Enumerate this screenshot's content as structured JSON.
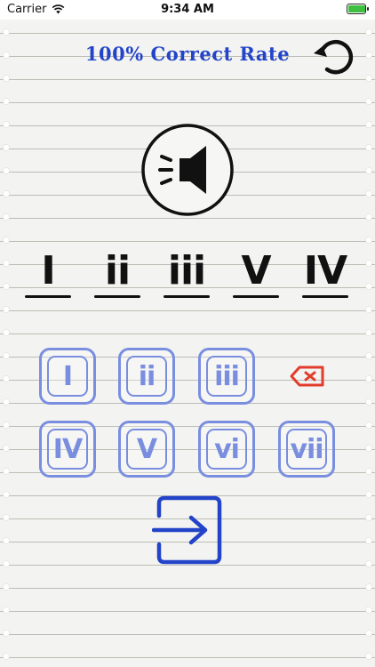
{
  "status_bar": {
    "carrier": "Carrier",
    "time": "9:34 AM",
    "battery_level": 0.95,
    "battery_color": "#3fbf3f"
  },
  "header": {
    "title": "100% Correct Rate",
    "title_color": "#2344c8",
    "refresh_icon": "refresh-icon"
  },
  "speaker": {
    "icon": "speaker-icon"
  },
  "answer": {
    "slots": [
      "I",
      "ii",
      "iii",
      "V",
      "IV"
    ]
  },
  "keypad": {
    "keys": [
      "I",
      "ii",
      "iii",
      "IV",
      "V",
      "vi",
      "vii"
    ],
    "key_color": "#7a8ee0",
    "delete_icon": "backspace-icon",
    "delete_color": "#e23c2c"
  },
  "submit": {
    "icon": "submit-arrow-icon",
    "color": "#2344c8"
  }
}
